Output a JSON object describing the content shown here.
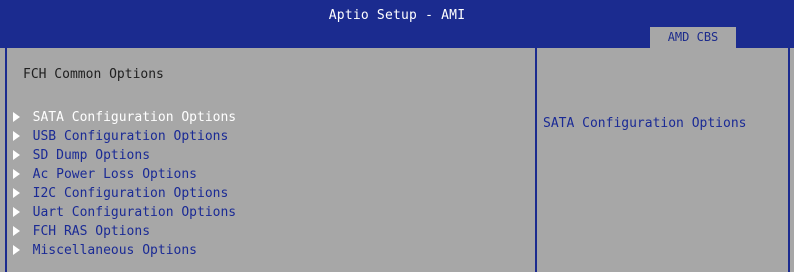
{
  "app": {
    "title": "Aptio Setup - AMI",
    "active_tab": "AMD CBS"
  },
  "main": {
    "section_title": "FCH Common Options",
    "items": [
      {
        "label": "SATA Configuration Options",
        "selected": true,
        "icon": "triangle-right-icon"
      },
      {
        "label": "USB Configuration Options",
        "selected": false,
        "icon": "triangle-right-icon"
      },
      {
        "label": "SD Dump Options",
        "selected": false,
        "icon": "triangle-right-icon"
      },
      {
        "label": "Ac Power Loss Options",
        "selected": false,
        "icon": "triangle-right-icon"
      },
      {
        "label": "I2C Configuration Options",
        "selected": false,
        "icon": "triangle-right-icon"
      },
      {
        "label": "Uart Configuration Options",
        "selected": false,
        "icon": "triangle-right-icon"
      },
      {
        "label": "FCH RAS Options",
        "selected": false,
        "icon": "triangle-right-icon"
      },
      {
        "label": "Miscellaneous Options",
        "selected": false,
        "icon": "triangle-right-icon"
      }
    ]
  },
  "help": {
    "text": "SATA Configuration Options"
  },
  "colors": {
    "header_blue": "#1b2b8f",
    "panel_gray": "#a7a7a7",
    "menu_blue": "#1a2a95",
    "selected_white": "#ffffff"
  }
}
